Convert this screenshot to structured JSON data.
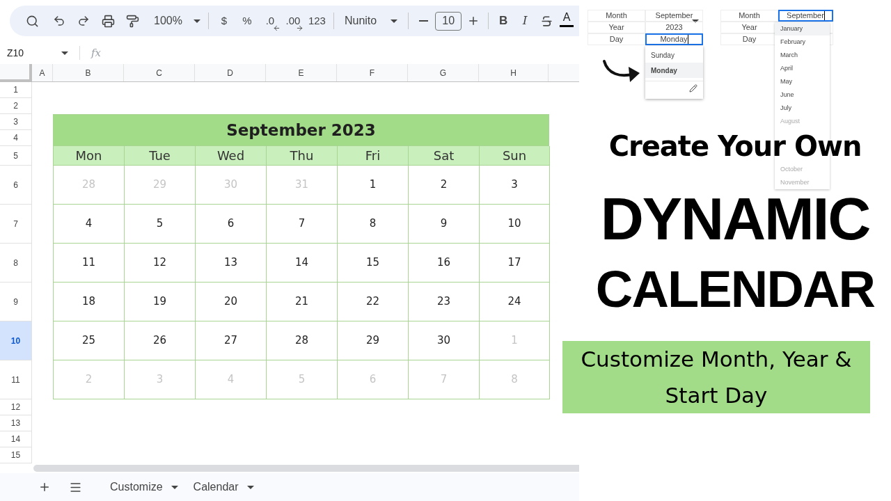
{
  "toolbar": {
    "zoom": "100%",
    "format_buttons": [
      {
        "kind": "currency",
        "label": "$"
      },
      {
        "kind": "percent",
        "label": "%"
      },
      {
        "kind": "decrease-decimal",
        "label": ".0"
      },
      {
        "kind": "increase-decimal",
        "label": ".00"
      },
      {
        "kind": "number-format",
        "label": "123"
      }
    ],
    "font": "Nunito",
    "font_size": "10",
    "style_buttons": [
      {
        "kind": "bold",
        "label": "B"
      },
      {
        "kind": "italic",
        "label": "I"
      },
      {
        "kind": "strikethrough"
      },
      {
        "kind": "text-color",
        "label": "A"
      }
    ]
  },
  "formula_bar": {
    "cell_ref": "Z10",
    "fx": "fx"
  },
  "columns": [
    "A",
    "B",
    "C",
    "D",
    "E",
    "F",
    "G",
    "H"
  ],
  "rows": [
    {
      "label": "1",
      "selected": false
    },
    {
      "label": "2",
      "selected": false
    },
    {
      "label": "3",
      "selected": false
    },
    {
      "label": "4",
      "selected": false
    },
    {
      "label": "5",
      "selected": false
    },
    {
      "label": "6",
      "selected": false
    },
    {
      "label": "7",
      "selected": false
    },
    {
      "label": "8",
      "selected": false
    },
    {
      "label": "9",
      "selected": false
    },
    {
      "label": "10",
      "selected": true
    },
    {
      "label": "11",
      "selected": false
    },
    {
      "label": "12",
      "selected": false
    },
    {
      "label": "13",
      "selected": false
    },
    {
      "label": "14",
      "selected": false
    },
    {
      "label": "15",
      "selected": false
    }
  ],
  "calendar": {
    "title": "September 2023",
    "weekdays": [
      "Mon",
      "Tue",
      "Wed",
      "Thu",
      "Fri",
      "Sat",
      "Sun"
    ],
    "weeks": [
      [
        {
          "day": "28",
          "muted": true
        },
        {
          "day": "29",
          "muted": true
        },
        {
          "day": "30",
          "muted": true
        },
        {
          "day": "31",
          "muted": true
        },
        {
          "day": "1",
          "muted": false
        },
        {
          "day": "2",
          "muted": false
        },
        {
          "day": "3",
          "muted": false
        }
      ],
      [
        {
          "day": "4",
          "muted": false
        },
        {
          "day": "5",
          "muted": false
        },
        {
          "day": "6",
          "muted": false
        },
        {
          "day": "7",
          "muted": false
        },
        {
          "day": "8",
          "muted": false
        },
        {
          "day": "9",
          "muted": false
        },
        {
          "day": "10",
          "muted": false
        }
      ],
      [
        {
          "day": "11",
          "muted": false
        },
        {
          "day": "12",
          "muted": false
        },
        {
          "day": "13",
          "muted": false
        },
        {
          "day": "14",
          "muted": false
        },
        {
          "day": "15",
          "muted": false
        },
        {
          "day": "16",
          "muted": false
        },
        {
          "day": "17",
          "muted": false
        }
      ],
      [
        {
          "day": "18",
          "muted": false
        },
        {
          "day": "19",
          "muted": false
        },
        {
          "day": "20",
          "muted": false
        },
        {
          "day": "21",
          "muted": false
        },
        {
          "day": "22",
          "muted": false
        },
        {
          "day": "23",
          "muted": false
        },
        {
          "day": "24",
          "muted": false
        }
      ],
      [
        {
          "day": "25",
          "muted": false
        },
        {
          "day": "26",
          "muted": false
        },
        {
          "day": "27",
          "muted": false
        },
        {
          "day": "28",
          "muted": false
        },
        {
          "day": "29",
          "muted": false
        },
        {
          "day": "30",
          "muted": false
        },
        {
          "day": "1",
          "muted": true
        }
      ],
      [
        {
          "day": "2",
          "muted": true
        },
        {
          "day": "3",
          "muted": true
        },
        {
          "day": "4",
          "muted": true
        },
        {
          "day": "5",
          "muted": true
        },
        {
          "day": "6",
          "muted": true
        },
        {
          "day": "7",
          "muted": true
        },
        {
          "day": "8",
          "muted": true
        }
      ]
    ]
  },
  "sheet_tabs": [
    "Customize",
    "Calendar"
  ],
  "day_demo": {
    "fields": [
      {
        "label": "Month",
        "value": "September",
        "dropdown": true,
        "editing": false
      },
      {
        "label": "Year",
        "value": "2023",
        "dropdown": false,
        "editing": false
      },
      {
        "label": "Day",
        "value": "Monday",
        "dropdown": false,
        "editing": true
      }
    ],
    "options": [
      {
        "label": "Sunday",
        "selected": false
      },
      {
        "label": "Monday",
        "selected": true
      }
    ]
  },
  "month_demo": {
    "fields": [
      {
        "label": "Month",
        "value": "September",
        "dropdown": false,
        "editing": true
      },
      {
        "label": "Year"
      },
      {
        "label": "Day"
      }
    ],
    "options": [
      {
        "label": "January",
        "selected": true,
        "muted": false
      },
      {
        "label": "February",
        "selected": false,
        "muted": false
      },
      {
        "label": "March",
        "selected": false,
        "muted": false
      },
      {
        "label": "April",
        "selected": false,
        "muted": false
      },
      {
        "label": "May",
        "selected": false,
        "muted": false
      },
      {
        "label": "June",
        "selected": false,
        "muted": false
      },
      {
        "label": "July",
        "selected": false,
        "muted": false
      },
      {
        "label": "August",
        "selected": false,
        "muted": true
      }
    ],
    "options_below_headline": [
      {
        "label": "October",
        "selected": false,
        "muted": true
      },
      {
        "label": "November",
        "selected": false,
        "muted": true
      }
    ]
  },
  "headline": {
    "intro": "Create Your Own",
    "line_1": "DYNAMIC",
    "line_2": "CALENDAR",
    "banner": "Customize Month, Year & Start Day"
  }
}
